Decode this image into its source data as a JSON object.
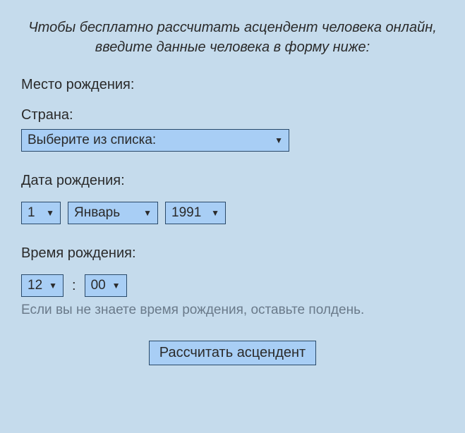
{
  "intro": "Чтобы бесплатно рассчитать асцендент человека онлайн, введите данные человека в форму ниже:",
  "birthplace": {
    "label": "Место рождения:"
  },
  "country": {
    "label": "Страна:",
    "selected": "Выберите из списка:"
  },
  "birthdate": {
    "label": "Дата рождения:",
    "day": "1",
    "month": "Январь",
    "year": "1991"
  },
  "birthtime": {
    "label": "Время рождения:",
    "hour": "12",
    "minute": "00",
    "hint": "Если вы не знаете время рождения, оставьте полдень."
  },
  "submit": {
    "label": "Рассчитать асцендент"
  }
}
